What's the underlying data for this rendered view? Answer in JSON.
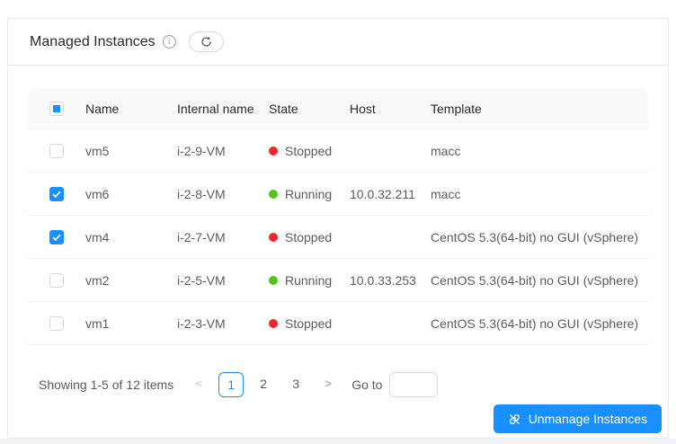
{
  "card": {
    "title": "Managed Instances",
    "info_icon_glyph": "i"
  },
  "table": {
    "columns": [
      "Name",
      "Internal name",
      "State",
      "Host",
      "Template"
    ],
    "header_checkbox_indeterminate": true,
    "rows": [
      {
        "checked": false,
        "name": "vm5",
        "internal_name": "i-2-9-VM",
        "state": {
          "label": "Stopped",
          "color": "#f5222d"
        },
        "host": "",
        "template": "macc"
      },
      {
        "checked": true,
        "name": "vm6",
        "internal_name": "i-2-8-VM",
        "state": {
          "label": "Running",
          "color": "#52c41a"
        },
        "host": "10.0.32.211",
        "template": "macc"
      },
      {
        "checked": true,
        "name": "vm4",
        "internal_name": "i-2-7-VM",
        "state": {
          "label": "Stopped",
          "color": "#f5222d"
        },
        "host": "",
        "template": "CentOS 5.3(64-bit) no GUI (vSphere)"
      },
      {
        "checked": false,
        "name": "vm2",
        "internal_name": "i-2-5-VM",
        "state": {
          "label": "Running",
          "color": "#52c41a"
        },
        "host": "10.0.33.253",
        "template": "CentOS 5.3(64-bit) no GUI (vSphere)"
      },
      {
        "checked": false,
        "name": "vm1",
        "internal_name": "i-2-3-VM",
        "state": {
          "label": "Stopped",
          "color": "#f5222d"
        },
        "host": "",
        "template": "CentOS 5.3(64-bit) no GUI (vSphere)"
      }
    ]
  },
  "pagination": {
    "summary": "Showing 1-5 of 12 items",
    "prev_icon": "<",
    "next_icon": ">",
    "pages": [
      {
        "label": "1",
        "active": true
      },
      {
        "label": "2",
        "active": false
      },
      {
        "label": "3",
        "active": false
      }
    ],
    "goto_label": "Go to",
    "goto_value": ""
  },
  "footer": {
    "unmanage_label": "Unmanage Instances"
  },
  "colors": {
    "primary": "#1890ff",
    "running": "#52c41a",
    "stopped": "#f5222d"
  }
}
